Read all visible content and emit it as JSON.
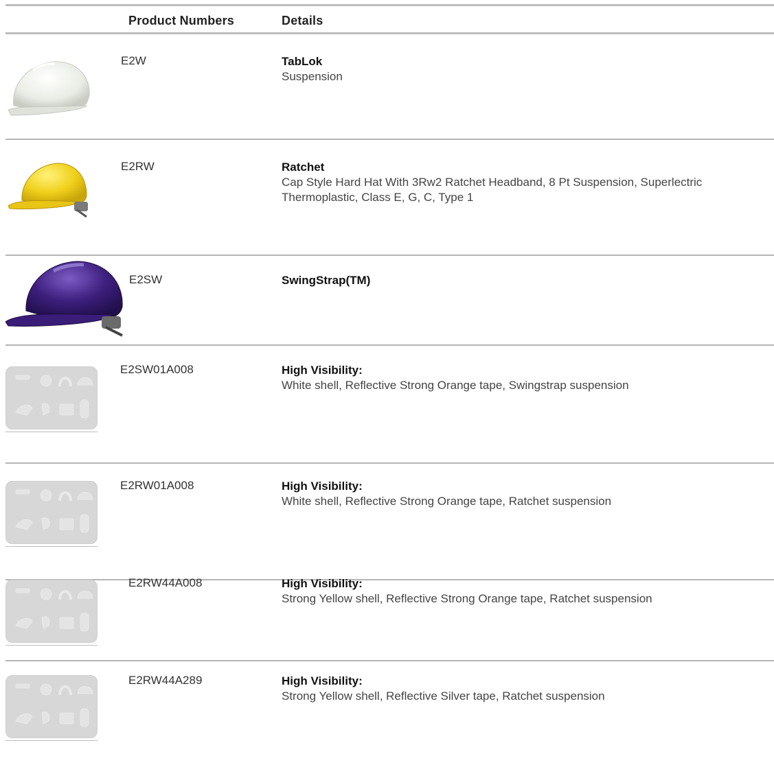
{
  "header": {
    "product_numbers": "Product Numbers",
    "details": "Details"
  },
  "rows": [
    {
      "product_number": "E2W",
      "title": "TabLok",
      "description": "Suspension",
      "image": "white-hard-hat",
      "hat_color": "#eef0ea"
    },
    {
      "product_number": "E2RW",
      "title": "Ratchet",
      "description": "Cap Style Hard Hat With 3Rw2 Ratchet Headband, 8 Pt Suspension, Superlectric Thermoplastic, Class E, G, C, Type 1",
      "image": "yellow-hard-hat",
      "hat_color": "#f2d220"
    },
    {
      "product_number": "E2SW",
      "title": "SwingStrap(TM)",
      "description": "",
      "image": "purple-hard-hat",
      "hat_color": "#3a1d78"
    },
    {
      "product_number": "E2SW01A008",
      "title": "High Visibility:",
      "description": "White shell, Reflective Strong Orange tape, Swingstrap suspension",
      "image": "placeholder-image"
    },
    {
      "product_number": "E2RW01A008",
      "title": "High Visibility:",
      "description": "White shell, Reflective Strong Orange tape, Ratchet suspension",
      "image": "placeholder-image"
    },
    {
      "product_number": "E2RW44A008",
      "title": "High Visibility:",
      "description": "Strong Yellow shell, Reflective Strong Orange tape, Ratchet suspension",
      "image": "placeholder-image"
    },
    {
      "product_number": "E2RW44A289",
      "title": "High Visibility:",
      "description": "Strong Yellow shell, Reflective Silver tape, Ratchet suspension",
      "image": "placeholder-image"
    }
  ]
}
